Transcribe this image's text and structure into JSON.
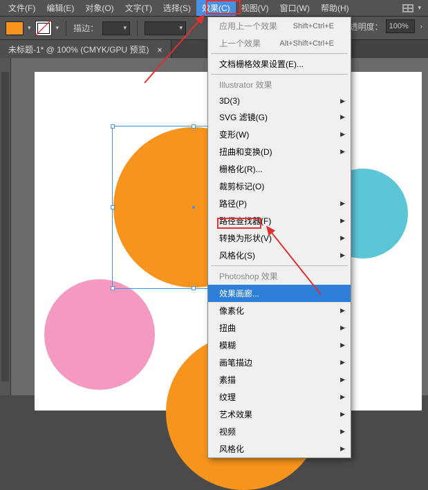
{
  "menu": {
    "file": "文件(F)",
    "edit": "编辑(E)",
    "object": "对象(O)",
    "type": "文字(T)",
    "select": "选择(S)",
    "effect": "效果(C)",
    "view": "视图(V)",
    "window": "窗口(W)",
    "help": "帮助(H)"
  },
  "toolbar": {
    "stroke_label": "描边：",
    "stroke_value": "",
    "opacity_label": "透明度：",
    "opacity_value": "100%"
  },
  "tab": {
    "title": "未标题-1* @ 100% (CMYK/GPU 预览)"
  },
  "dropdown": {
    "apply_last": "应用上一个效果",
    "apply_last_sc": "Shift+Ctrl+E",
    "last_effect": "上一个效果",
    "last_effect_sc": "Alt+Shift+Ctrl+E",
    "doc_raster": "文档栅格效果设置(E)...",
    "sec_illustrator": "Illustrator 效果",
    "i3d": "3D(3)",
    "svg": "SVG 滤镜(G)",
    "transform": "变形(W)",
    "distort": "扭曲和变换(D)",
    "rasterize": "栅格化(R)...",
    "crop": "裁剪标记(O)",
    "path": "路径(P)",
    "pathfinder": "路径查找器(F)",
    "convert": "转换为形状(V)",
    "stylize1": "风格化(S)",
    "sec_photoshop": "Photoshop 效果",
    "gallery": "效果画廊...",
    "pixelate": "像素化",
    "distort2": "扭曲",
    "blur": "模糊",
    "brush": "画笔描边",
    "sketch": "素描",
    "texture": "纹理",
    "artistic": "艺术效果",
    "video": "视频",
    "stylize2": "风格化"
  }
}
